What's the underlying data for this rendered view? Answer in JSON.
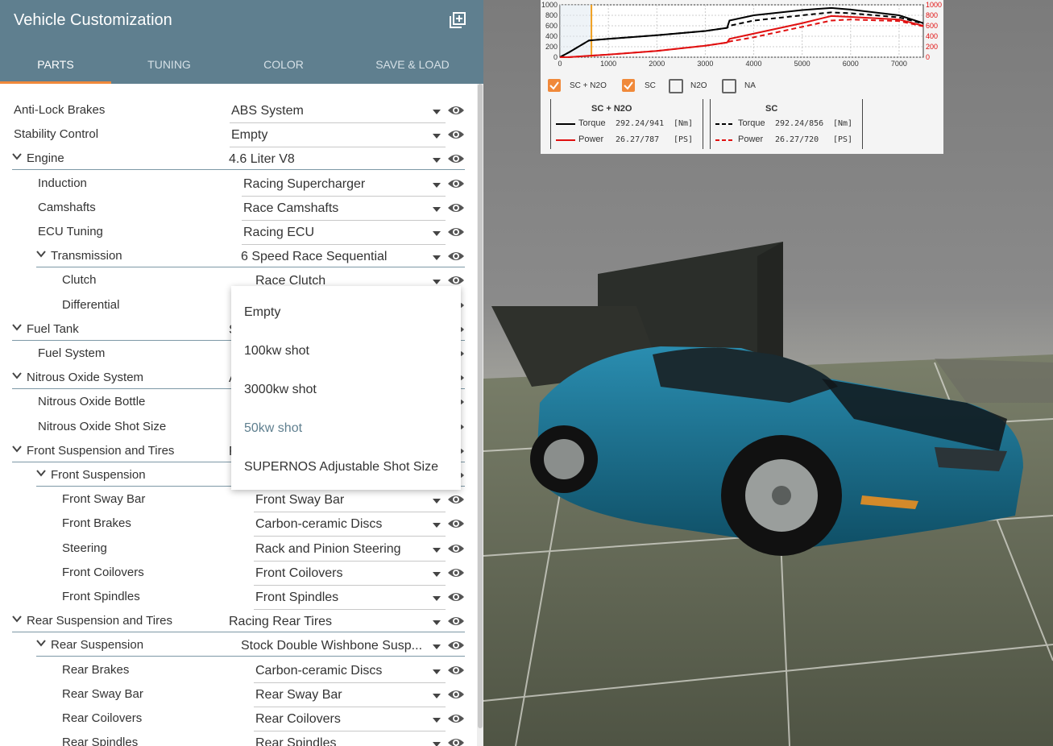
{
  "panel": {
    "title": "Vehicle Customization",
    "tabs": [
      {
        "label": "PARTS",
        "active": true
      },
      {
        "label": "TUNING",
        "active": false
      },
      {
        "label": "COLOR",
        "active": false
      },
      {
        "label": "SAVE & LOAD",
        "active": false
      }
    ],
    "rows": [
      {
        "label": "Anti-Lock Brakes",
        "value": "ABS System"
      },
      {
        "label": "Stability Control",
        "value": "Empty"
      },
      {
        "label": "Engine",
        "value": "4.6 Liter V8"
      },
      {
        "label": "Induction",
        "value": "Racing Supercharger"
      },
      {
        "label": "Camshafts",
        "value": "Race Camshafts"
      },
      {
        "label": "ECU Tuning",
        "value": "Racing ECU"
      },
      {
        "label": "Transmission",
        "value": "6 Speed Race Sequential"
      },
      {
        "label": "Clutch",
        "value": "Race Clutch"
      },
      {
        "label": "Differential",
        "value": ""
      },
      {
        "label": "Fuel Tank",
        "value": "S"
      },
      {
        "label": "Fuel System",
        "value": ""
      },
      {
        "label": "Nitrous Oxide System",
        "value": "A"
      },
      {
        "label": "Nitrous Oxide Bottle",
        "value": ""
      },
      {
        "label": "Nitrous Oxide Shot Size",
        "value": ""
      },
      {
        "label": "Front Suspension and Tires",
        "value": "F"
      },
      {
        "label": "Front Suspension",
        "value": ""
      },
      {
        "label": "Front Sway Bar",
        "value": "Front Sway Bar"
      },
      {
        "label": "Front Brakes",
        "value": "Carbon-ceramic Discs"
      },
      {
        "label": "Steering",
        "value": "Rack and Pinion Steering"
      },
      {
        "label": "Front Coilovers",
        "value": "Front Coilovers"
      },
      {
        "label": "Front Spindles",
        "value": "Front Spindles"
      },
      {
        "label": "Rear Suspension and Tires",
        "value": "Racing Rear Tires"
      },
      {
        "label": "Rear Suspension",
        "value": "Stock Double Wishbone Susp..."
      },
      {
        "label": "Rear Brakes",
        "value": "Carbon-ceramic Discs"
      },
      {
        "label": "Rear Sway Bar",
        "value": "Rear Sway Bar"
      },
      {
        "label": "Rear Coilovers",
        "value": "Rear Coilovers"
      },
      {
        "label": "Rear Spindles",
        "value": "Rear Spindles"
      }
    ],
    "dropdown_options": [
      "Empty",
      "100kw shot",
      "3000kw shot",
      "50kw shot",
      "SUPERNOS Adjustable Shot Size"
    ],
    "dropdown_selected": "50kw shot"
  },
  "graph": {
    "left_ticks": [
      "1000",
      "800",
      "600",
      "400",
      "200",
      "0"
    ],
    "right_ticks": [
      "1000",
      "800",
      "600",
      "400",
      "200",
      "0"
    ],
    "x_ticks": [
      "0",
      "1000",
      "2000",
      "3000",
      "4000",
      "5000",
      "6000",
      "7000"
    ],
    "toggles": [
      {
        "label": "SC + N2O",
        "checked": true
      },
      {
        "label": "SC",
        "checked": true
      },
      {
        "label": "N2O",
        "checked": false
      },
      {
        "label": "NA",
        "checked": false
      }
    ],
    "legend": [
      {
        "title": "SC + N2O",
        "torque_label": "Torque",
        "torque_value": "292.24/941",
        "torque_unit": "[Nm]",
        "power_label": "Power",
        "power_value": "26.27/787",
        "power_unit": "[PS]"
      },
      {
        "title": "SC",
        "torque_label": "Torque",
        "torque_value": "292.24/856",
        "torque_unit": "[Nm]",
        "power_label": "Power",
        "power_value": "26.27/720",
        "power_unit": "[PS]"
      }
    ],
    "colors": {
      "torque": "#000000",
      "power": "#e01010",
      "cursor": "#f0a020"
    }
  },
  "chart_data": {
    "type": "line",
    "x": [
      0,
      200,
      600,
      1000,
      2000,
      3000,
      3450,
      3500,
      4000,
      5000,
      5600,
      6000,
      7000,
      7500
    ],
    "series": [
      {
        "name": "SC + N2O Torque",
        "values": [
          0,
          100,
          320,
          350,
          420,
          500,
          560,
          700,
          800,
          900,
          941,
          910,
          800,
          650
        ]
      },
      {
        "name": "SC Torque",
        "values": [
          0,
          100,
          320,
          350,
          420,
          500,
          560,
          600,
          700,
          800,
          856,
          840,
          760,
          640
        ]
      },
      {
        "name": "SC + N2O Power",
        "values": [
          0,
          2,
          26,
          50,
          120,
          220,
          280,
          350,
          450,
          650,
          787,
          770,
          720,
          600
        ]
      },
      {
        "name": "SC Power",
        "values": [
          0,
          2,
          26,
          50,
          120,
          220,
          280,
          300,
          380,
          580,
          700,
          720,
          690,
          590
        ]
      }
    ],
    "xlim": [
      0,
      7500
    ],
    "ylim": [
      0,
      1000
    ],
    "y2lim": [
      0,
      1000
    ],
    "cursor_x": 650,
    "grid": true
  }
}
